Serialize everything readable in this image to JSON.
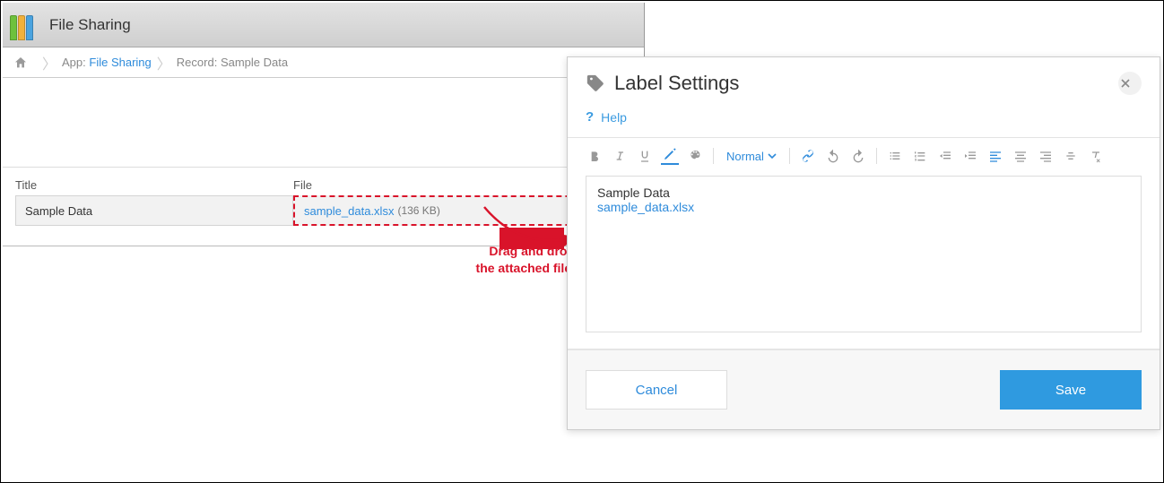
{
  "header": {
    "title": "File Sharing"
  },
  "breadcrumb": {
    "app_prefix": "App:",
    "app_name": "File Sharing",
    "record_prefix": "Record:",
    "record_name": "Sample Data"
  },
  "record": {
    "title_label": "Title",
    "title_value": "Sample Data",
    "file_label": "File",
    "file_name": "sample_data.xlsx",
    "file_size": "(136 KB)"
  },
  "annotation": {
    "drag_line1": "Drag and drop",
    "drag_line2": "the attached file."
  },
  "modal": {
    "title": "Label Settings",
    "help": "Help",
    "format_selector": "Normal",
    "editor_line1": "Sample Data",
    "editor_line2": "sample_data.xlsx",
    "cancel": "Cancel",
    "save": "Save"
  }
}
